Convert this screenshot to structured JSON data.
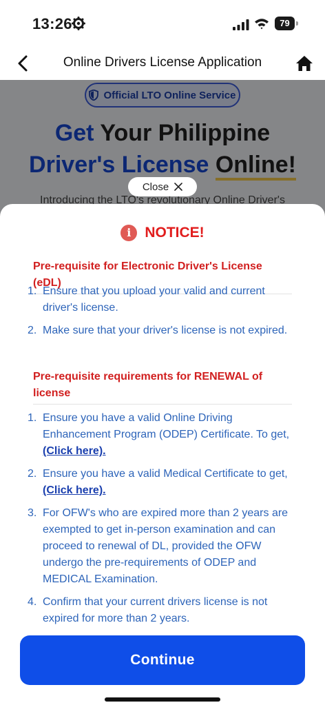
{
  "status": {
    "time": "13:26",
    "battery": "79"
  },
  "header": {
    "title": "Online Drivers License Application"
  },
  "background": {
    "badge": "Official LTO Online Service",
    "hero_word1": "Get",
    "hero_word2": " Your Philippine",
    "hero_word3": "Driver's License",
    "hero_word4": "Online!",
    "intro": "Introducing the LTO's revolutionary Online Driver's"
  },
  "close_label": "Close",
  "notice": {
    "title": "NOTICE!",
    "section1_title": "Pre-requisite for Electronic Driver's License (eDL)",
    "section1_items": [
      {
        "num": "1.",
        "text": "Ensure that you upload your valid and current driver's license."
      },
      {
        "num": "2.",
        "text": "Make sure that your driver's license is not expired."
      }
    ],
    "section2_title": "Pre-requisite requirements for RENEWAL of license",
    "section2_items": [
      {
        "num": "1.",
        "text": "Ensure you have a valid Online Driving Enhancement Program (ODEP) Certificate. To get, ",
        "link": "(Click here)."
      },
      {
        "num": "2.",
        "text": "Ensure you have a valid Medical Certificate to get, ",
        "link": "(Click here)."
      },
      {
        "num": "3.",
        "text": "For OFW's who are expired more than 2 years are exempted to get in-person examination and can proceed to renewal of DL, provided the OFW undergo the pre-requirements of ODEP and MEDICAL Examination."
      },
      {
        "num": "4.",
        "text": "Confirm that your current drivers license is not expired for more than 2 years."
      }
    ]
  },
  "continue_label": "Continue"
}
